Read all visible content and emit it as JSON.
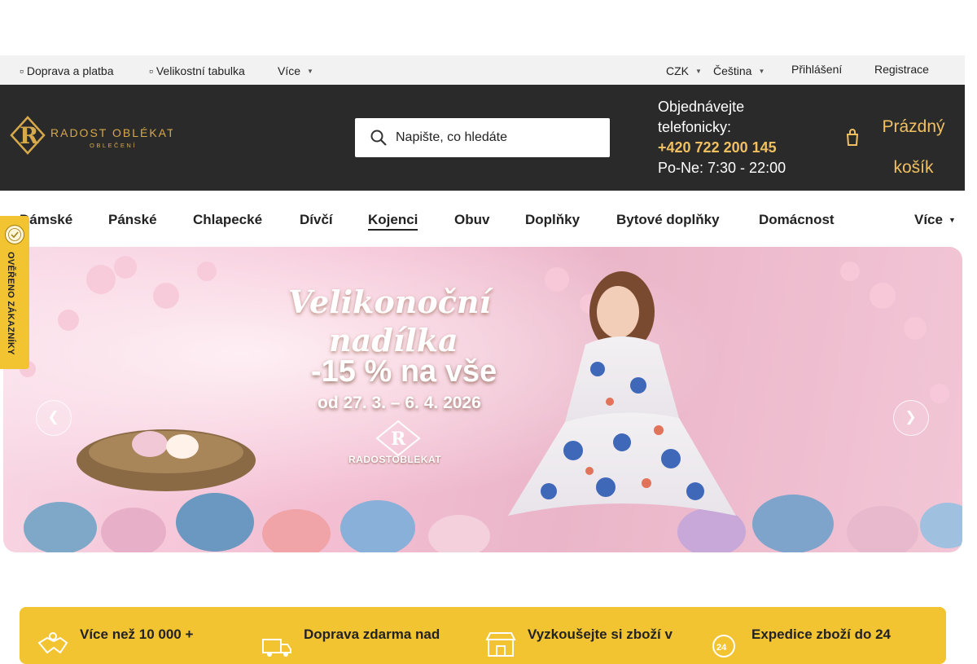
{
  "topbar": {
    "shipping": "Doprava a platba",
    "size_table": "Velikostní tabulka",
    "more": "Více",
    "currency": "CZK",
    "language": "Čeština",
    "login": "Přihlášení",
    "register": "Registrace"
  },
  "header": {
    "logo_text": "RADOST OBLÉKAT",
    "logo_subtext": "OBLEČENÍ",
    "search_placeholder": "Napište, co hledáte",
    "phone_intro": "Objednávejte telefonicky:",
    "phone_number": "+420 722 200 145",
    "phone_hours": "Po-Ne: 7:30 - 22:00",
    "cart_label": "Prázdný košík"
  },
  "nav": {
    "items": [
      "Dámské",
      "Pánské",
      "Chlapecké",
      "Dívčí",
      "Kojenci",
      "Obuv",
      "Doplňky",
      "Bytové doplňky",
      "Domácnost"
    ],
    "active": "Kojenci",
    "more": "Více"
  },
  "badge": {
    "text": "OVĚŘENO ZÁKAZNÍKY"
  },
  "banner": {
    "title_line1": "Velikonoční",
    "title_line2": "nadílka",
    "promo": "-15 % na vše",
    "dates": "od 27. 3. – 6. 4. 2026",
    "brand": "RADOSTOBLEKAT"
  },
  "benefits": [
    {
      "text": "Více než 10 000 +",
      "icon": "handshake-icon"
    },
    {
      "text": "Doprava zdarma nad",
      "icon": "delivery-truck-icon"
    },
    {
      "text": "Vyzkoušejte si zboží v",
      "icon": "store-icon"
    },
    {
      "text": "Expedice zboží do 24",
      "icon": "24h-clock-icon"
    }
  ],
  "colors": {
    "accent": "#f3c431",
    "header_bg": "#2a2a2a",
    "gold_text": "#f0c060"
  }
}
